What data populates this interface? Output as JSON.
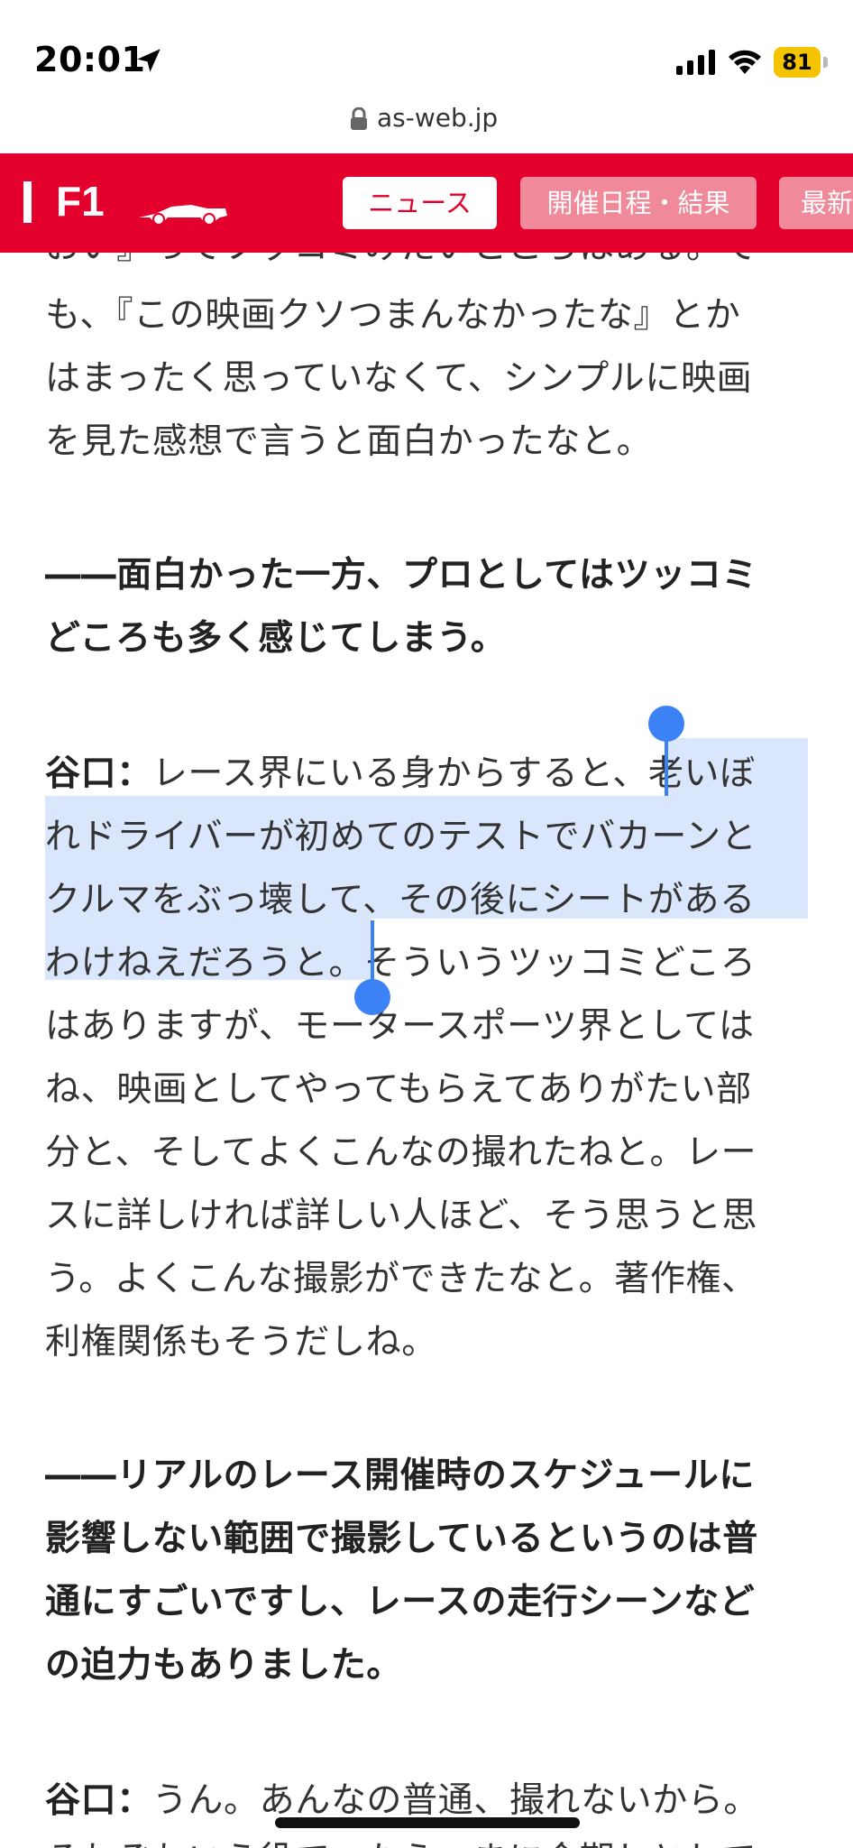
{
  "status_bar": {
    "time": "20:01",
    "battery": "81"
  },
  "url_bar": {
    "domain": "as-web.jp"
  },
  "header": {
    "brand": "F1",
    "tabs": [
      "ニュース",
      "開催日程・結果",
      "最新"
    ]
  },
  "article": {
    "lines": [
      "おい』ってツッコミみたいところはある。で",
      "も、『この映画クソつまんなかったな』とか",
      "はまったく思っていなくて、シンプルに映画",
      "を見た感想で言うと面白かったなと。",
      "――面白かった一方、プロとしてはツッコミ",
      "どころも多く感じてしまう。",
      "レース界にいる身からすると、老いぼ",
      "れドライバーが初めてのテストでバカーンと",
      "クルマをぶっ壊して、その後にシートがある",
      "わけねえだろうと。そういうツッコミどころ",
      "はありますが、モータースポーツ界としては",
      "ね、映画としてやってもらえてありがたい部",
      "分と、そしてよくこんなの撮れたねと。レー",
      "スに詳しければ詳しい人ほど、そう思うと思",
      "う。よくこんな撮影ができたなと。著作権、",
      "利権関係もそうだしね。",
      "――リアルのレース開催時のスケジュールに",
      "影響しない範囲で撮影しているというのは普",
      "通にすごいですし、レースの走行シーンなど",
      "の迫力もありました。",
      "うん。あんなの普通、撮れないから。",
      "それぞれいう役で、たえーまに会期しとして"
    ],
    "speaker": "谷口："
  }
}
